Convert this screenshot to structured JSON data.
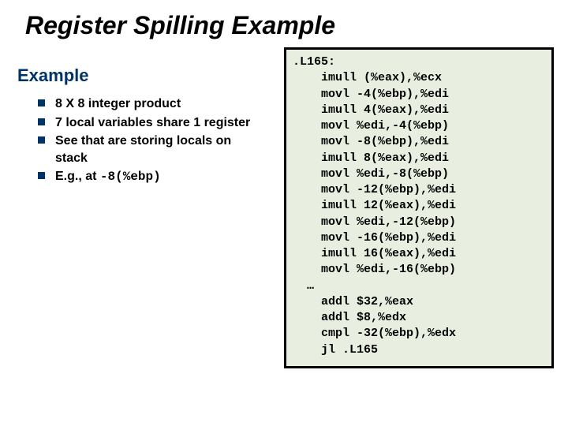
{
  "title": "Register Spilling Example",
  "subtitle": "Example",
  "bullets": [
    {
      "text": "8 X 8 integer product"
    },
    {
      "text": "7 local variables share 1 register"
    },
    {
      "text": "See that are storing locals on stack"
    },
    {
      "prefix": "E.g., at ",
      "code": "-8(%ebp)"
    }
  ],
  "code_label": ".L165:",
  "code_body": [
    "imull (%eax),%ecx",
    "movl -4(%ebp),%edi",
    "imull 4(%eax),%edi",
    "movl %edi,-4(%ebp)",
    "movl -8(%ebp),%edi",
    "imull 8(%eax),%edi",
    "movl %edi,-8(%ebp)",
    "movl -12(%ebp),%edi",
    "imull 12(%eax),%edi",
    "movl %edi,-12(%ebp)",
    "movl -16(%ebp),%edi",
    "imull 16(%eax),%edi",
    "movl %edi,-16(%ebp)"
  ],
  "code_ellipsis": "…",
  "code_tail": [
    "addl $32,%eax",
    "addl $8,%edx",
    "cmpl -32(%ebp),%edx",
    "jl .L165"
  ]
}
